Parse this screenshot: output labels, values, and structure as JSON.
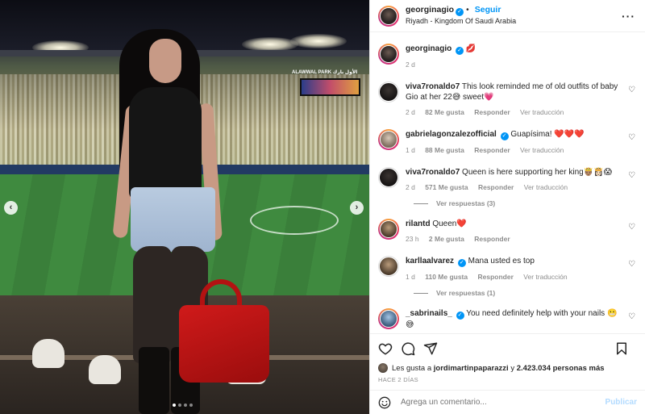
{
  "colors": {
    "accent": "#0095f6",
    "verified": "#0095f6",
    "muted": "#8e8e8e",
    "text": "#262626",
    "publish_disabled": "#b3dbff"
  },
  "photo": {
    "scoreboard_text": "ALAWWAL PARK الأول بارك",
    "nav_prev_icon": "chevron-left-icon",
    "nav_next_icon": "chevron-right-icon",
    "carousel_dots": 4,
    "active_dot": 0
  },
  "header": {
    "username": "georginagio",
    "follow_label": "Seguir",
    "separator": "•",
    "location": "Riyadh - Kingdom Of Saudi Arabia",
    "more_icon": "more-options-icon"
  },
  "caption": {
    "username": "georginagio",
    "text": "💋",
    "time": "2 d"
  },
  "comments": [
    {
      "username": "viva7ronaldo7",
      "verified": false,
      "text": "This look reminded me of old outfits of baby Gio at her 22😅 sweet💗",
      "time": "2 d",
      "likes": "82 Me gusta",
      "reply": "Responder",
      "translate": "Ver traducción"
    },
    {
      "username": "gabrielagonzalezofficial",
      "verified": true,
      "text": "Guapísima! ❤️❤️❤️",
      "time": "1 d",
      "likes": "88 Me gusta",
      "reply": "Responder",
      "translate": "Ver traducción"
    },
    {
      "username": "viva7ronaldo7",
      "verified": false,
      "text": "Queen is here supporting her king🤴🏽👸🏻😱",
      "time": "2 d",
      "likes": "571 Me gusta",
      "reply": "Responder",
      "translate": "Ver traducción",
      "replies": "Ver respuestas (3)"
    },
    {
      "username": "rilantd",
      "verified": false,
      "text": "Queen❤️",
      "time": "23 h",
      "likes": "2 Me gusta",
      "reply": "Responder"
    },
    {
      "username": "karllaalvarez",
      "verified": true,
      "text": "Mana usted es top",
      "time": "1 d",
      "likes": "110 Me gusta",
      "reply": "Responder",
      "translate": "Ver traducción",
      "replies": "Ver respuestas (1)"
    },
    {
      "username": "_sabrinails_",
      "verified": true,
      "text": "You need definitely help with your nails 😬😅",
      "time": "",
      "likes": "",
      "reply": ""
    }
  ],
  "actions": {
    "like_icon": "heart-icon",
    "comment_icon": "comment-icon",
    "share_icon": "share-icon",
    "save_icon": "bookmark-icon"
  },
  "likes": {
    "prefix": "Les gusta a",
    "user": "jordimartinpaparazzi",
    "mid": "y",
    "count": "2.423.034 personas más"
  },
  "post_time": "HACE 2 DÍAS",
  "composer": {
    "placeholder": "Agrega un comentario...",
    "publish_label": "Publicar",
    "emoji_icon": "emoji-icon"
  }
}
